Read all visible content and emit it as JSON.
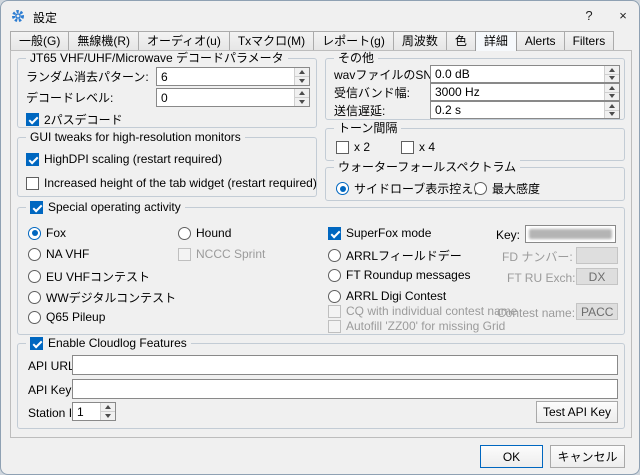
{
  "window": {
    "title": "設定",
    "help_label": "?",
    "close_label": "×"
  },
  "tabs": [
    {
      "label": "一般(G)"
    },
    {
      "label": "無線機(R)"
    },
    {
      "label": "オーディオ(u)"
    },
    {
      "label": "Txマクロ(M)"
    },
    {
      "label": "レポート(g)"
    },
    {
      "label": "周波数"
    },
    {
      "label": "色"
    },
    {
      "label": "詳細"
    },
    {
      "label": "Alerts"
    },
    {
      "label": "Filters"
    }
  ],
  "jt65": {
    "title": "JT65 VHF/UHF/Microwave デコードパラメータ",
    "random_erasure_label": "ランダム消去パターン:",
    "random_erasure_value": "6",
    "decode_level_label": "デコードレベル:",
    "decode_level_value": "0",
    "two_pass_label": "2パスデコード"
  },
  "misc": {
    "title": "その他",
    "wav_sn_label": "wavファイルのSN比を落とす:",
    "wav_sn_value": "0.0 dB",
    "rx_bw_label": "受信バンド幅:",
    "rx_bw_value": "3000  Hz",
    "tx_delay_label": "送信遅延:",
    "tx_delay_value": "0.2  s"
  },
  "tone_spacing": {
    "title": "トーン間隔",
    "x2_label": "x 2",
    "x4_label": "x 4"
  },
  "waterfall": {
    "title": "ウォーターフォールスペクトラム",
    "low_sidelobes_label": "サイドローブ表示控え目",
    "most_sensitive_label": "最大感度"
  },
  "gui_tweaks": {
    "title": "GUI tweaks for high-resolution monitors",
    "highdpi_label": "HighDPI scaling (restart required)",
    "tab_height_label": "Increased height of the tab widget (restart required)"
  },
  "special": {
    "title": "Special operating activity",
    "fox_label": "Fox",
    "hound_label": "Hound",
    "na_vhf_label": "NA VHF",
    "nccc_label": "NCCC Sprint",
    "eu_vhf_label": "EU VHFコンテスト",
    "ww_digi_label": "WWデジタルコンテスト",
    "q65_pileup_label": "Q65 Pileup",
    "superfox_label": "SuperFox mode",
    "key_label": "Key:",
    "arrl_fd_label": "ARRLフィールドデー",
    "fd_number_label": "FD ナンバー:",
    "fd_number_value": "",
    "ft_roundup_label": "FT Roundup messages",
    "ft_ru_label": "FT RU Exch:",
    "ft_ru_value": "DX",
    "arrl_digi_label": "ARRL Digi Contest",
    "cq_contest_label": "CQ with individual contest name",
    "contest_name_label": "Contest name:",
    "contest_name_value": "PACC",
    "autofill_label": "Autofill 'ZZ00' for missing Grid"
  },
  "cloudlog": {
    "title": "Enable Cloudlog Features",
    "api_url_label": "API URL:",
    "api_url_value": "",
    "api_key_label": "API Key:",
    "api_key_value": "",
    "station_id_label": "Station ID:",
    "station_id_value": "1",
    "test_button_label": "Test API Key"
  },
  "footer": {
    "ok_label": "OK",
    "cancel_label": "キャンセル"
  }
}
